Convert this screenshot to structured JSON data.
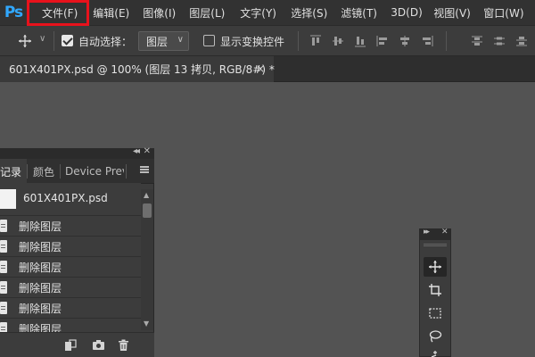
{
  "app": {
    "logo": "Ps"
  },
  "menu": {
    "items": [
      "文件(F)",
      "编辑(E)",
      "图像(I)",
      "图层(L)",
      "文字(Y)",
      "选择(S)",
      "滤镜(T)",
      "3D(D)",
      "视图(V)",
      "窗口(W)"
    ]
  },
  "options_bar": {
    "auto_select_label": "自动选择：",
    "auto_select_checked": true,
    "target_value": "图层",
    "show_transform_label": "显示变换控件",
    "show_transform_checked": false,
    "tool_icon": "move-icon"
  },
  "document": {
    "tab_title": "601X401PX.psd @ 100% (图层 13 拷贝, RGB/8#) *",
    "close_glyph": "×"
  },
  "history_panel": {
    "tabs": [
      "记录",
      "颜色",
      "Device Previ"
    ],
    "active_tab": 0,
    "snapshot_name": "601X401PX.psd",
    "items": [
      "删除图层",
      "删除图层",
      "删除图层",
      "删除图层",
      "删除图层",
      "删除图层"
    ],
    "footer_icons": [
      "new-document-from-state-icon",
      "camera-icon",
      "trash-icon"
    ]
  },
  "tools_panel": {
    "tools": [
      "move-icon",
      "artboard-icon",
      "marquee-icon",
      "lasso-icon",
      "magic-wand-icon"
    ],
    "selected": 0
  }
}
